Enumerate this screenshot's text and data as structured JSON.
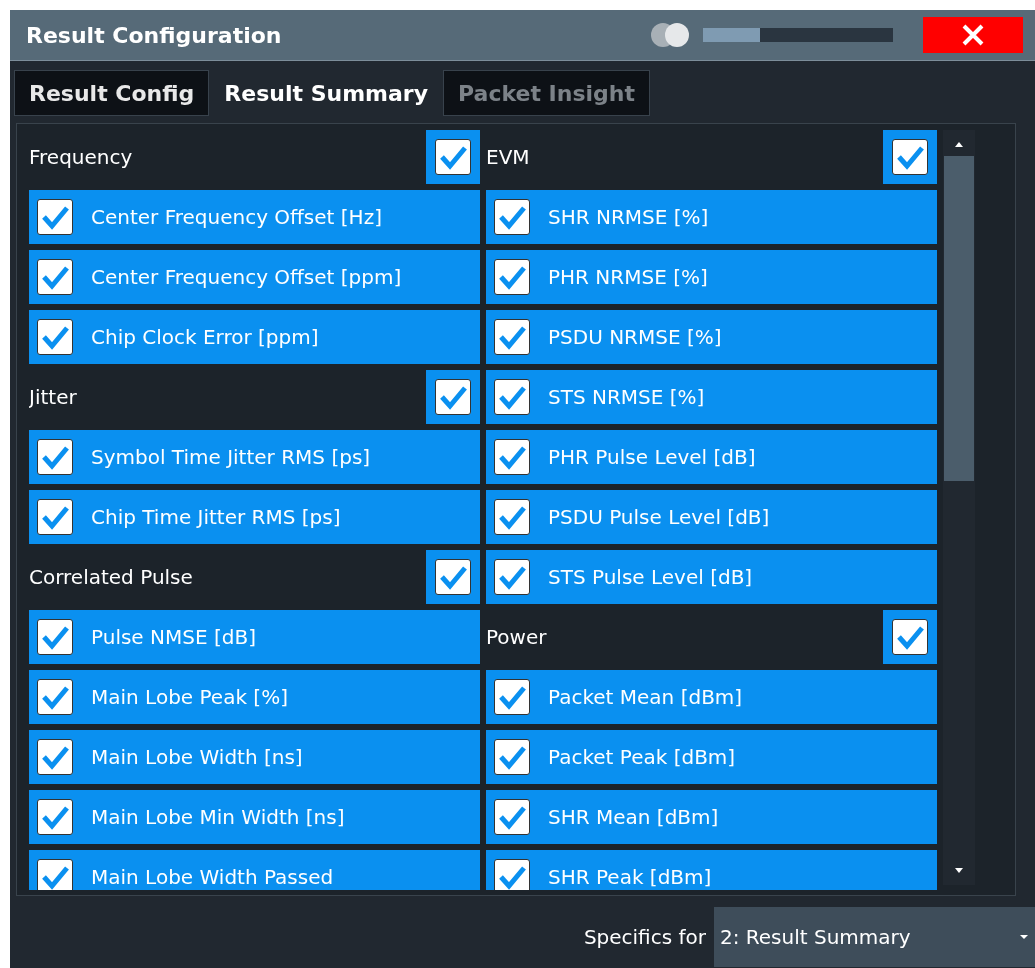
{
  "window": {
    "title": "Result Configuration",
    "opacity_slider": {
      "level": 0.3
    }
  },
  "tabs": [
    {
      "label": "Result Config",
      "selected": false,
      "disabled": false
    },
    {
      "label": "Result Summary",
      "selected": true,
      "disabled": false
    },
    {
      "label": "Packet Insight",
      "selected": false,
      "disabled": true
    }
  ],
  "columns": [
    [
      {
        "label": "Frequency",
        "checked": true,
        "items": [
          {
            "label": "Center Frequency Offset [Hz]",
            "checked": true
          },
          {
            "label": "Center Frequency Offset [ppm]",
            "checked": true
          },
          {
            "label": "Chip Clock Error [ppm]",
            "checked": true
          }
        ]
      },
      {
        "label": "Jitter",
        "checked": true,
        "items": [
          {
            "label": "Symbol Time Jitter RMS [ps]",
            "checked": true
          },
          {
            "label": "Chip Time Jitter RMS [ps]",
            "checked": true
          }
        ]
      },
      {
        "label": "Correlated Pulse",
        "checked": true,
        "items": [
          {
            "label": "Pulse NMSE [dB]",
            "checked": true
          },
          {
            "label": "Main Lobe Peak [%]",
            "checked": true
          },
          {
            "label": "Main Lobe Width [ns]",
            "checked": true
          },
          {
            "label": "Main Lobe Min Width [ns]",
            "checked": true
          },
          {
            "label": "Main Lobe Width Passed",
            "checked": true
          }
        ]
      }
    ],
    [
      {
        "label": "EVM",
        "checked": true,
        "items": [
          {
            "label": "SHR NRMSE [%]",
            "checked": true
          },
          {
            "label": "PHR NRMSE [%]",
            "checked": true
          },
          {
            "label": "PSDU NRMSE [%]",
            "checked": true
          },
          {
            "label": "STS NRMSE [%]",
            "checked": true
          },
          {
            "label": "PHR Pulse Level [dB]",
            "checked": true
          },
          {
            "label": "PSDU Pulse Level [dB]",
            "checked": true
          },
          {
            "label": "STS Pulse Level [dB]",
            "checked": true
          }
        ]
      },
      {
        "label": "Power",
        "checked": true,
        "items": [
          {
            "label": "Packet Mean [dBm]",
            "checked": true
          },
          {
            "label": "Packet Peak [dBm]",
            "checked": true
          },
          {
            "label": "SHR Mean [dBm]",
            "checked": true
          },
          {
            "label": "SHR Peak [dBm]",
            "checked": true
          }
        ]
      }
    ]
  ],
  "footer": {
    "label": "Specifics for",
    "dropdown": {
      "value": "2: Result Summary"
    }
  }
}
